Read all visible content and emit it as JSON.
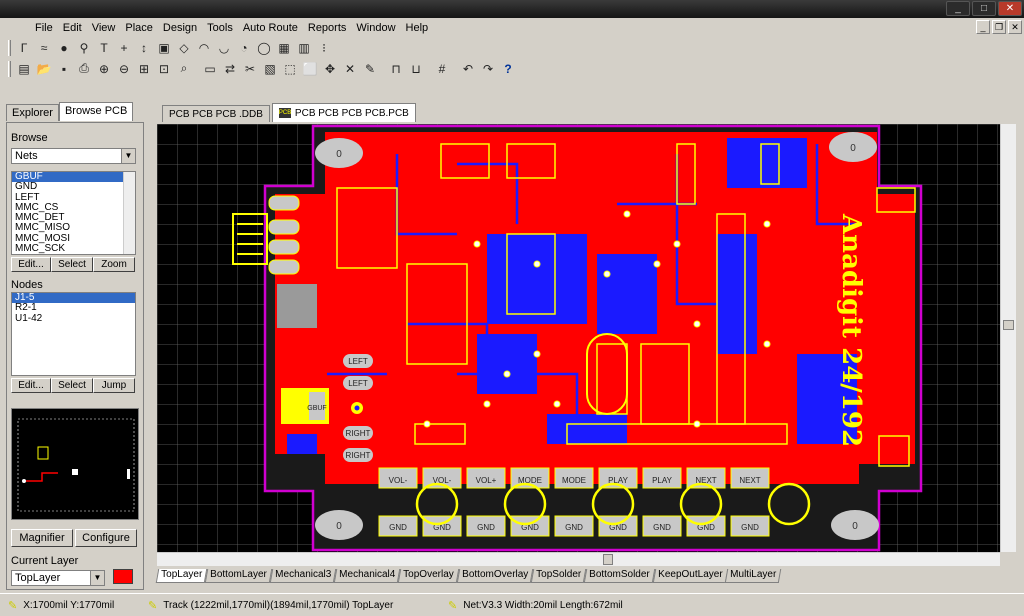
{
  "window": {
    "title": ""
  },
  "menu": [
    "File",
    "Edit",
    "View",
    "Place",
    "Design",
    "Tools",
    "Auto Route",
    "Reports",
    "Window",
    "Help"
  ],
  "panel": {
    "tabs": [
      "Explorer",
      "Browse PCB"
    ],
    "browse_label": "Browse",
    "browse_value": "Nets",
    "nets": [
      "GBUF",
      "GND",
      "LEFT",
      "MMC_CS",
      "MMC_DET",
      "MMC_MISO",
      "MMC_MOSI",
      "MMC_SCK"
    ],
    "nets_buttons": [
      "Edit...",
      "Select",
      "Zoom"
    ],
    "nodes_label": "Nodes",
    "nodes": [
      "J1-5",
      "R2-1",
      "U1-42"
    ],
    "nodes_buttons": [
      "Edit...",
      "Select",
      "Jump"
    ],
    "magnifier": "Magnifier",
    "configure": "Configure",
    "current_layer_label": "Current Layer",
    "current_layer": "TopLayer",
    "layer_color": "#ff0000"
  },
  "doc_tabs": [
    "PCB PCB PCB .DDB",
    "PCB PCB PCB PCB.PCB"
  ],
  "layer_tabs": [
    "TopLayer",
    "BottomLayer",
    "Mechanical3",
    "Mechanical4",
    "TopOverlay",
    "BottomOverlay",
    "TopSolder",
    "BottomSolder",
    "KeepOutLayer",
    "MultiLayer"
  ],
  "board": {
    "brand": "Anadigit 24/192",
    "mount_label": "0",
    "pads": [
      "VOL-",
      "VOL-",
      "VOL+",
      "MODE",
      "MODE",
      "PLAY",
      "PLAY",
      "NEXT",
      "NEXT"
    ],
    "pad_gnd": "GND",
    "pad_nums": [
      "1",
      "2"
    ],
    "side_labels": [
      "LEFT",
      "LEFT",
      "RIGHT",
      "RIGHT"
    ],
    "gbuf_label": "GBUF"
  },
  "status": {
    "coords": "X:1700mil Y:1770mil",
    "track": "Track (1222mil,1770mil)(1894mil,1770mil)  TopLayer",
    "net": "Net:V3.3 Width:20mil Length:672mil"
  }
}
